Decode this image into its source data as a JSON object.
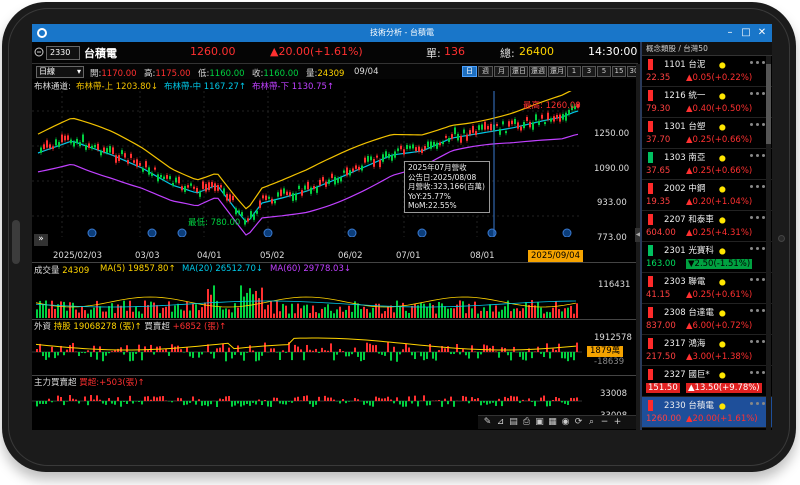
{
  "window": {
    "title": "技術分析 - 台積電"
  },
  "quote": {
    "code": "2330",
    "name": "台積電",
    "price": "1260.00",
    "change": "▲20.00(+1.61%)",
    "vol_label": "單:",
    "vol": "136",
    "total_label": "總:",
    "total": "26400",
    "time": "14:30:00"
  },
  "ohlc": {
    "period_select": "日線",
    "open_label": "開:",
    "open": "1170.00",
    "high_label": "高:",
    "high": "1175.00",
    "low_label": "低:",
    "low": "1160.00",
    "close_label": "收:",
    "close": "1160.00",
    "vol_label": "量:",
    "vol": "24309",
    "date": "09/04",
    "timeframes": [
      "日",
      "週",
      "月",
      "還日",
      "還週",
      "還月",
      "1",
      "3",
      "5",
      "15",
      "30",
      "60"
    ],
    "active_timeframe": "日"
  },
  "main_chart": {
    "legend_name": "布林通道:",
    "upper": "布林帶-上 1203.80↓",
    "mid": "布林帶-中 1167.27↑",
    "lower": "布林帶-下 1130.75↑",
    "high_note": "最高: 1260.00",
    "low_note": "最低: 780.00",
    "tooltip": [
      "2025年07月營收",
      "公告日:2025/08/08",
      "月營收:323,166(百萬)",
      "YoY:25.77%",
      "MoM:22.55%"
    ],
    "month_marker": "月",
    "y_ticks": [
      "1250.00",
      "1090.00",
      "933.00",
      "773.00"
    ],
    "x_ticks": [
      "2025/02/03",
      "03/03",
      "04/01",
      "05/02",
      "06/02",
      "07/01",
      "08/01"
    ],
    "cursor_date": "2025/09/04"
  },
  "volume_panel": {
    "label": "成交量",
    "value": "24309",
    "ma5_label": "MA(5)",
    "ma5": "19857.80↑",
    "ma20_label": "MA(20)",
    "ma20": "26512.70↓",
    "ma60_label": "MA(60)",
    "ma60": "29778.03↓",
    "y_tick": "116431"
  },
  "foreign_panel": {
    "label": "外資",
    "hold": "持股 19068278 (張)↑",
    "net_label": "買賣超",
    "net": "+6852 (張)↑",
    "y_ticks": [
      "1912578",
      "1879萬",
      "-18639"
    ]
  },
  "main_force_panel": {
    "label": "主力買賣超",
    "value": "買超:+503(張)↑",
    "y_ticks": [
      "33008",
      "-33008"
    ]
  },
  "sidebar": {
    "header": "概念類股 / 台灣50",
    "items": [
      {
        "code": "1101 台泥",
        "price": "22.35",
        "change": "▲0.05(+0.22%)",
        "flag": "#ff2a2a",
        "price_color": "#ff4040"
      },
      {
        "code": "1216 統一",
        "price": "79.30",
        "change": "▲0.40(+0.50%)",
        "flag": "#ff2a2a",
        "price_color": "#ff4040"
      },
      {
        "code": "1301 台塑",
        "price": "37.70",
        "change": "▲0.25(+0.66%)",
        "flag": "#ff2a2a",
        "price_color": "#ff4040"
      },
      {
        "code": "1303 南亞",
        "price": "37.65",
        "change": "▲0.25(+0.66%)",
        "flag": "#00c060",
        "price_color": "#ff4040"
      },
      {
        "code": "2002 中鋼",
        "price": "19.35",
        "change": "▲0.20(+1.04%)",
        "flag": "#ff2a2a",
        "price_color": "#ff4040"
      },
      {
        "code": "2207 和泰車",
        "price": "604.00",
        "change": "▲0.25(+4.31%)",
        "flag": "#ff2a2a",
        "price_color": "#ff4040"
      },
      {
        "code": "2301 光寶科",
        "price": "163.00",
        "change": "▼2.50(-1.51%)",
        "flag": "#00c060",
        "price_color": "#00e060",
        "highlight": "green"
      },
      {
        "code": "2303 聯電",
        "price": "41.15",
        "change": "▲0.25(+0.61%)",
        "flag": "#ff2a2a",
        "price_color": "#ff4040"
      },
      {
        "code": "2308 台達電",
        "price": "837.00",
        "change": "▲6.00(+0.72%)",
        "flag": "#ff2a2a",
        "price_color": "#ff4040"
      },
      {
        "code": "2317 鴻海",
        "price": "217.50",
        "change": "▲3.00(+1.38%)",
        "flag": "#ff2a2a",
        "price_color": "#ff4040"
      },
      {
        "code": "2327 國巨*",
        "price": "151.50",
        "change": "▲13.50(+9.78%)",
        "flag": "#ff2a2a",
        "price_color": "#ffffff",
        "highlight": "red"
      },
      {
        "code": "2330 台積電",
        "price": "1260.00",
        "change": "▲20.00(+1.61%)",
        "flag": "#ff2a2a",
        "price_color": "#ff4040",
        "highlight": "selected"
      }
    ]
  },
  "colors": {
    "up": "#ff3030",
    "down": "#00d040",
    "upper_band": "#f2c200",
    "mid_band": "#00c8e8",
    "lower_band": "#c040ff",
    "accent": "#1976c9"
  }
}
